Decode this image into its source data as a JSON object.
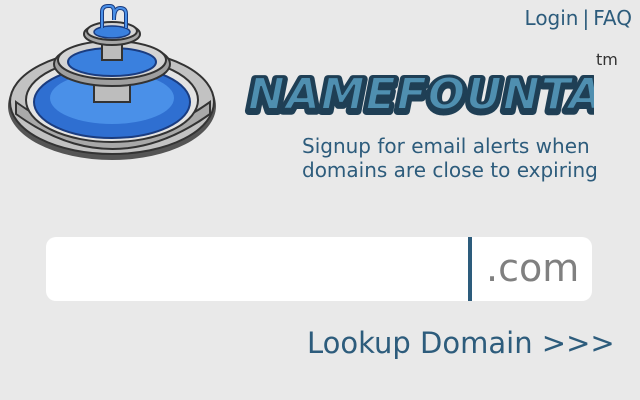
{
  "nav": {
    "login": "Login",
    "separator": "|",
    "faq": "FAQ"
  },
  "brand": {
    "name": "NAMEFOUNTAIN",
    "trademark": "tm",
    "logo_icon": "fountain-icon"
  },
  "tagline": {
    "line1": "Signup for email alerts when",
    "line2": "domains are close to expiring"
  },
  "search": {
    "value": "",
    "placeholder": "",
    "tld": ".com"
  },
  "lookup_button": "Lookup Domain >>>",
  "colors": {
    "background": "#e9e9e9",
    "text_primary": "#2d5c7c",
    "brand_fill": "#4f8fb0",
    "brand_outline": "#1f3f55",
    "water": "#3e83de",
    "stone": "#b9b9b9"
  }
}
